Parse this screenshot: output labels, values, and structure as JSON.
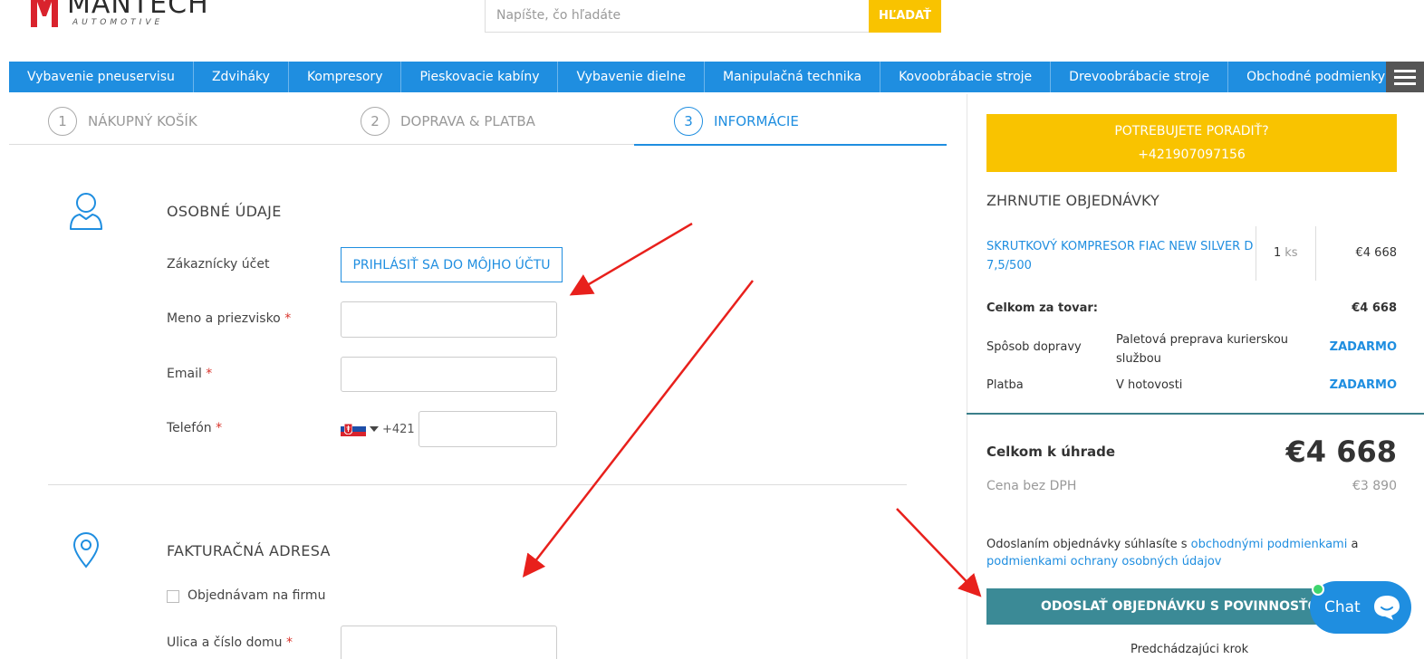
{
  "header": {
    "logo_name": "MANTECH",
    "logo_sub": "AUTOMOTIVE",
    "search_placeholder": "Napíšte, čo hľadáte",
    "search_button": "HĽADAŤ"
  },
  "nav": {
    "items": [
      "Vybavenie pneuservisu",
      "Zdviháky",
      "Kompresory",
      "Pieskovacie kabíny",
      "Vybavenie dielne",
      "Manipulačná technika",
      "Kovoobrábacie stroje",
      "Drevoobrábacie stroje",
      "Obchodné podmienky"
    ]
  },
  "steps": [
    {
      "num": "1",
      "label": "NÁKUPNÝ KOŠÍK"
    },
    {
      "num": "2",
      "label": "DOPRAVA & PLATBA"
    },
    {
      "num": "3",
      "label": "INFORMÁCIE"
    }
  ],
  "personal": {
    "title": "OSOBNÉ ÚDAJE",
    "account_label": "Zákaznícky účet",
    "login_button": "PRIHLÁSIŤ SA DO MÔJHO ÚČTU",
    "name_label": "Meno a priezvisko",
    "email_label": "Email",
    "phone_label": "Telefón",
    "phone_prefix": "+421",
    "required_mark": "*"
  },
  "billing": {
    "title": "FAKTURAČNÁ ADRESA",
    "company_checkbox": "Objednávam na firmu",
    "street_label": "Ulica a číslo domu"
  },
  "sidebar": {
    "advice_line1": "POTREBUJETE PORADIŤ?",
    "advice_line2": "+421907097156",
    "summary_title": "ZHRNUTIE OBJEDNÁVKY",
    "product_name": "SKRUTKOVÝ KOMPRESOR FIAC NEW SILVER D 7,5/500",
    "product_qty": "1",
    "product_unit": "ks",
    "product_price": "€4 668",
    "goods_total_label": "Celkom za tovar:",
    "goods_total_value": "€4 668",
    "shipping_label": "Spôsob dopravy",
    "shipping_value": "Paletová preprava kurierskou službou",
    "shipping_price": "ZADARMO",
    "payment_label": "Platba",
    "payment_value": "V hotovosti",
    "payment_price": "ZADARMO",
    "grand_total_label": "Celkom k úhrade",
    "grand_total_value": "€4 668",
    "netto_label": "Cena bez DPH",
    "netto_value": "€3 890",
    "terms_text": "Odoslaním objednávky súhlasíte s",
    "terms_link1": "obchodnými podmienkami",
    "terms_and": "a",
    "terms_link2": "podmienkami ochrany osobných údajov",
    "submit_button": "ODOSLAŤ OBJEDNÁVKU S POVINNOSŤOU PLATBY",
    "prev_step": "Predchádzajúci krok"
  },
  "chat": {
    "label": "Chat"
  },
  "colors": {
    "primary": "#1f8ee0",
    "accent_yellow": "#f9c300",
    "submit_teal": "#3b8a96",
    "annotation_arrow": "#e8201c"
  }
}
